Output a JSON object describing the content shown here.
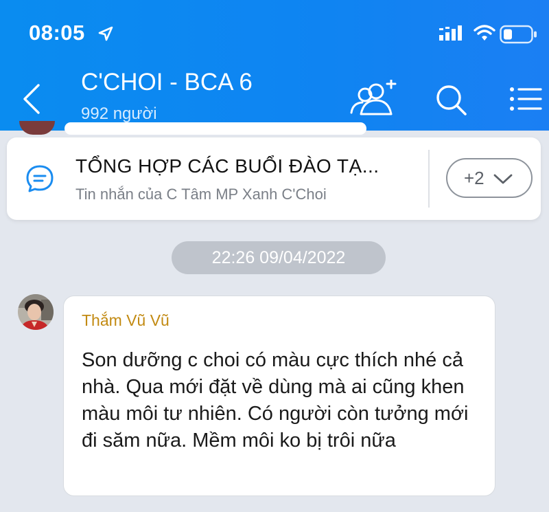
{
  "status_bar": {
    "time": "08:05",
    "icons": [
      "location-arrow-icon",
      "signal-icon",
      "wifi-icon",
      "battery-icon"
    ]
  },
  "header": {
    "title": "C'CHOI - BCA 6",
    "subtitle": "992 người",
    "icons": [
      "back-chevron-icon",
      "add-member-icon",
      "search-icon",
      "menu-list-icon"
    ]
  },
  "pinned": {
    "title": "TỔNG HỢP CÁC BUỔI ĐÀO TẠ...",
    "subtitle": "Tin nhắn của C Tâm MP Xanh C'Choi",
    "more_label": "+2",
    "icons": [
      "chat-bubble-icon",
      "chevron-down-icon"
    ]
  },
  "chat": {
    "date_separator": "22:26 09/04/2022",
    "message": {
      "sender": "Thắm Vũ Vũ",
      "text": "Son dưỡng c choi có màu cực thích nhé cả nhà. Qua mới đặt về dùng mà ai cũng khen màu môi tư nhiên. Có người còn tưởng mới đi săm nữa. Mềm môi ko bị trôi nữa"
    }
  },
  "colors": {
    "header_blue": "#0f84f2",
    "sender_name": "#c28a12",
    "chat_background": "#e3e7ee"
  }
}
